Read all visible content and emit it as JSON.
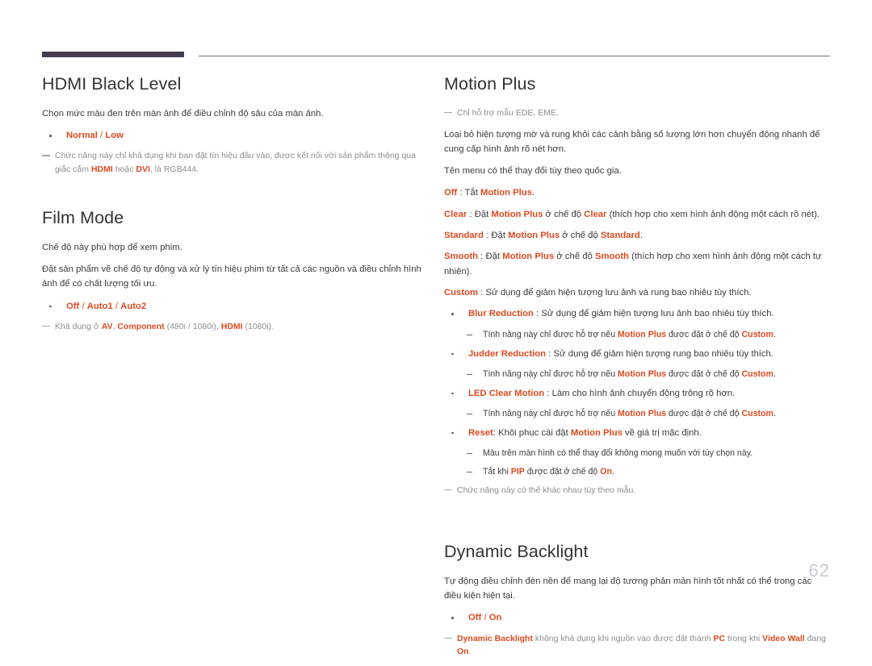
{
  "document": {
    "page_number": "62",
    "accent_color": "#dd4a20",
    "rule_color": "#443a52",
    "note_color": "#8d8d8d"
  },
  "left_column": {
    "sections": [
      {
        "title": "HDMI Black Level",
        "intro": "Chọn mức màu đen trên màn ảnh để điều chỉnh độ sâu của màn ảnh.",
        "options_bullet": {
          "opt1": "Normal",
          "sep": " / ",
          "opt2": "Low"
        },
        "note": {
          "part1": "Chức năng này chỉ khả dụng khi bạn đặt tín hiệu đầu vào, được kết nối với sản phẩm thông qua giắc cắm ",
          "term1": "HDMI",
          "part2": " hoặc ",
          "term2": "DVI",
          "part3": ", là RGB444."
        }
      },
      {
        "title": "Film Mode",
        "intro": "Chế độ này phù hợp để xem phim.",
        "body2": "Đặt sản phẩm về chế độ tự động và xử lý tín hiệu phim từ tất cả các nguồn và điều chỉnh hình ảnh để có chất lượng tối ưu.",
        "options_bullet": {
          "opt1": "Off",
          "sep1": " / ",
          "opt2": "Auto1",
          "sep2": " / ",
          "opt3": "Auto2"
        },
        "note": {
          "part1": "Khả dụng ở ",
          "term1": "AV",
          "part2": ", ",
          "term2": "Component",
          "part3": " (480i / 1080i), ",
          "term3": "HDMI",
          "part4": " (1080i)."
        }
      }
    ]
  },
  "right_column": {
    "sections": [
      {
        "title": "Motion Plus",
        "note_top": "Chỉ hỗ trợ mẫu EDE, EME.",
        "body1": "Loại bỏ hiện tượng mờ và rung khỏi các cảnh bằng số lượng lớn hơn chuyển động nhanh để cung cấp hình ảnh rõ nét hơn.",
        "body2": "Tên menu có thể thay đổi tùy theo quốc gia.",
        "definitions": [
          {
            "term": "Off",
            "colon": " : ",
            "desc_pre": "Tắt ",
            "desc_term": "Motion Plus",
            "desc_post": "."
          },
          {
            "term": "Clear",
            "colon": " : ",
            "desc_pre": "Đặt ",
            "desc_term": "Motion Plus",
            "desc_mid": " ở chế độ ",
            "desc_term2": "Clear",
            "desc_post": " (thích hợp cho xem hình ảnh động một cách rõ nét)."
          },
          {
            "term": "Standard",
            "colon": " : ",
            "desc_pre": "Đặt ",
            "desc_term": "Motion Plus",
            "desc_mid": " ở chế độ ",
            "desc_term2": "Standard",
            "desc_post": "."
          },
          {
            "term": "Smooth",
            "colon": " : ",
            "desc_pre": "Đặt ",
            "desc_term": "Motion Plus",
            "desc_mid": " ở chế độ ",
            "desc_term2": "Smooth",
            "desc_post": " (thích hợp cho xem hình ảnh động một cách tự nhiên)."
          },
          {
            "term": "Custom",
            "colon": " : ",
            "desc_pre": "Sử dụng để giảm hiện tượng lưu ảnh và rung bao nhiêu tùy thích.",
            "desc_term": "",
            "desc_post": ""
          }
        ],
        "sub_items": [
          {
            "term": "Blur Reduction",
            "colon": " : ",
            "desc": "Sử dụng để giảm hiện tượng lưu ảnh bao nhiêu tùy thích.",
            "sub_note": {
              "pre": "Tính năng này chỉ được hỗ trợ nếu ",
              "term1": "Motion Plus",
              "mid": " được đặt ở chế độ ",
              "term2": "Custom",
              "post": "."
            }
          },
          {
            "term": "Judder Reduction",
            "colon": " : ",
            "desc": "Sử dụng để giảm hiện tượng rung bao nhiêu tùy thích.",
            "sub_note": {
              "pre": "Tính năng này chỉ được hỗ trợ nếu ",
              "term1": "Motion Plus",
              "mid": " được đặt ở chế độ ",
              "term2": "Custom",
              "post": "."
            }
          },
          {
            "term": "LED Clear Motion",
            "colon": " : ",
            "desc": "Làm cho hình ảnh chuyển động trông rõ hơn.",
            "sub_note": {
              "pre": "Tính năng này chỉ được hỗ trợ nếu ",
              "term1": "Motion Plus",
              "mid": " được đặt ở chế độ ",
              "term2": "Custom",
              "post": "."
            }
          }
        ],
        "reset_item": {
          "term": "Reset",
          "colon": ": ",
          "desc_pre": "Khôi phục cài đặt ",
          "desc_term": "Motion Plus",
          "desc_post": " về giá trị mặc định.",
          "sub_note1": "Màu trên màn hình có thể thay đổi không mong muốn với tùy chọn này.",
          "sub_note2": {
            "pre": "Tắt khi ",
            "term1": "PIP",
            "mid": " được đặt ở chế độ ",
            "term2": "On",
            "post": "."
          }
        },
        "note_bottom": "Chức năng này có thể khác nhau tùy theo mẫu."
      },
      {
        "title": "Dynamic Backlight",
        "intro": "Tự động điều chỉnh đèn nền để mang lại độ tương phản màn hình tốt nhất có thể trong các điều kiện hiện tại.",
        "options_bullet": {
          "opt1": "Off",
          "sep": " / ",
          "opt2": "On"
        },
        "note": {
          "term1": "Dynamic Backlight",
          "part1": " không khả dụng khi nguồn vào được đặt thành ",
          "term2": "PC",
          "part2": " trong khi ",
          "term3": "Video Wall",
          "part3": " đang ",
          "term4": "On",
          "part4": "."
        }
      }
    ]
  }
}
